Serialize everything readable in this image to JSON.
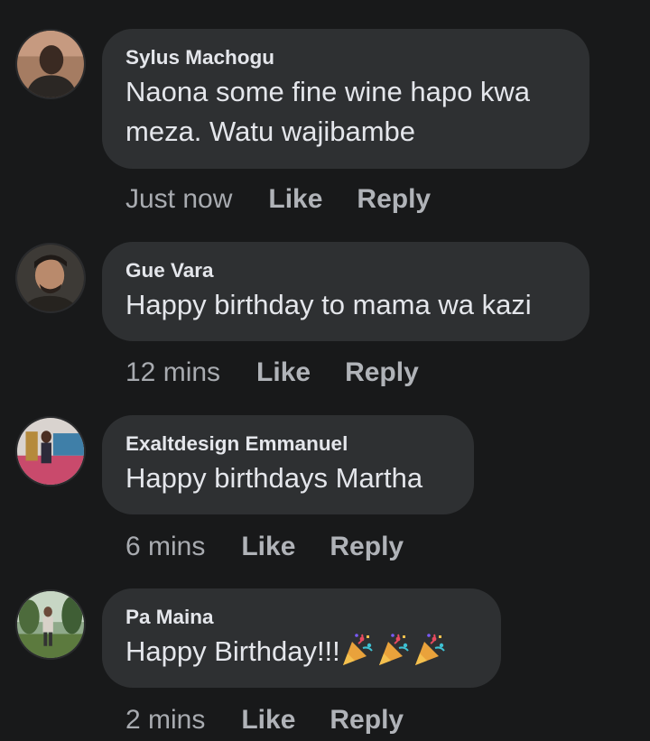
{
  "comments": [
    {
      "author": "Sylus Machogu",
      "text_lines": [
        "Naona some fine wine hapo kwa",
        "meza. Watu wajibambe"
      ],
      "time": "Just now",
      "like_label": "Like",
      "reply_label": "Reply",
      "avatar_icon": "person-photo-avatar"
    },
    {
      "author": "Gue Vara",
      "text_lines": [
        "Happy birthday to mama wa kazi"
      ],
      "time": "12 mins",
      "like_label": "Like",
      "reply_label": "Reply",
      "avatar_icon": "person-photo-avatar"
    },
    {
      "author": "Exaltdesign Emmanuel",
      "text_lines": [
        "Happy birthdays Martha"
      ],
      "time": "6 mins",
      "like_label": "Like",
      "reply_label": "Reply",
      "avatar_icon": "person-photo-avatar"
    },
    {
      "author": "Pa Maina",
      "text_lines": [
        "Happy Birthday!!!"
      ],
      "emoji": [
        "party-popper-icon",
        "party-popper-icon",
        "party-popper-icon"
      ],
      "time": "2 mins",
      "like_label": "Like",
      "reply_label": "Reply",
      "avatar_icon": "person-photo-avatar"
    }
  ],
  "colors": {
    "background": "#18191a",
    "bubble": "#2e3032",
    "text": "#e4e6eb",
    "meta": "#b0b3b8"
  }
}
